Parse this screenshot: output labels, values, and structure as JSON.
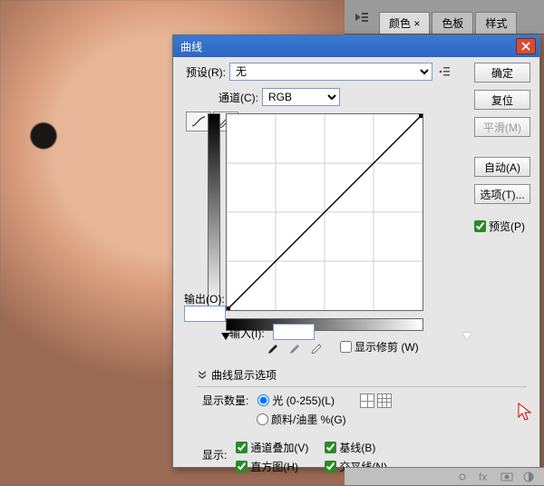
{
  "panel": {
    "tabs": [
      "颜色 ×",
      "色板",
      "样式"
    ]
  },
  "dialog": {
    "title": "曲线",
    "preset_label": "预设(R):",
    "preset_value": "无",
    "channel_label": "通道(C):",
    "channel_value": "RGB",
    "output_label": "输出(O):",
    "output_value": "",
    "input_label": "输入(I):",
    "input_value": "",
    "clip_checkbox": "显示修剪 (W)",
    "expander_label": "曲线显示选项",
    "amount_label": "显示数量:",
    "amount_light": "光 (0-255)(L)",
    "amount_ink": "颜料/油墨 %(G)",
    "show_label": "显示:",
    "show_overlay": "通道叠加(V)",
    "show_baseline": "基线(B)",
    "show_hist": "直方图(H)",
    "show_cross": "交叉线(N)"
  },
  "buttons": {
    "ok": "确定",
    "reset": "复位",
    "smooth": "平滑(M)",
    "auto": "自动(A)",
    "options": "选项(T)...",
    "preview": "预览(P)"
  },
  "chart_data": {
    "type": "line",
    "title": "",
    "xlabel": "输入",
    "ylabel": "输出",
    "xlim": [
      0,
      255
    ],
    "ylim": [
      0,
      255
    ],
    "series": [
      {
        "name": "RGB",
        "x": [
          0,
          255
        ],
        "y": [
          0,
          255
        ]
      }
    ],
    "control_points": [
      {
        "x": 0,
        "y": 0
      },
      {
        "x": 255,
        "y": 255
      }
    ],
    "grid": {
      "x_divisions": 4,
      "y_divisions": 4
    }
  }
}
